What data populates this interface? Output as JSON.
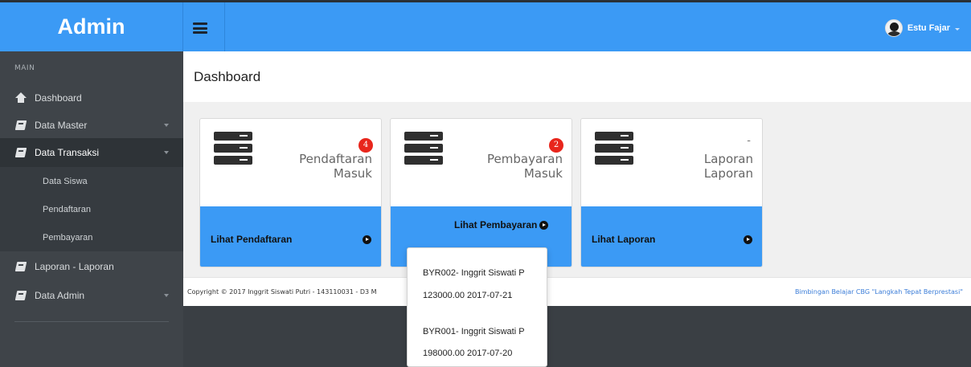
{
  "brand": "Admin",
  "user": {
    "name": "Estu Fajar"
  },
  "sidebar": {
    "section_label": "MAIN",
    "items": [
      {
        "label": "Dashboard"
      },
      {
        "label": "Data Master"
      },
      {
        "label": "Data Transaksi"
      },
      {
        "label": "Laporan - Laporan"
      },
      {
        "label": "Data Admin"
      }
    ],
    "subitems": [
      {
        "label": "Data Siswa"
      },
      {
        "label": "Pendaftaran"
      },
      {
        "label": "Pembayaran"
      }
    ]
  },
  "page": {
    "title": "Dashboard"
  },
  "cards": [
    {
      "badge": "4",
      "line1": "Pendaftaran",
      "line2": "Masuk",
      "link": "Lihat Pendaftaran"
    },
    {
      "badge": "2",
      "line1": "Pembayaran",
      "line2": "Masuk",
      "link": "Lihat Pembayaran"
    },
    {
      "badge": "-",
      "line1": "Laporan",
      "line2": "Laporan",
      "link": "Lihat Laporan"
    }
  ],
  "footer": {
    "copyright": "Copyright © 2017 Inggrit Siswati Putri - 143110031 - D3 M",
    "tagline": "Bimbingan Belajar CBG \"Langkah Tepat Berprestasi\""
  },
  "popover": {
    "entries": [
      {
        "title": "BYR002- Inggrit Siswati P",
        "detail": "123000.00 2017-07-21"
      },
      {
        "title": "BYR001- Inggrit Siswati P",
        "detail": "198000.00 2017-07-20"
      }
    ]
  },
  "colors": {
    "header_blue": "#3b9af5",
    "sidebar_dark": "#3f4449",
    "badge_red": "#e8261c"
  }
}
